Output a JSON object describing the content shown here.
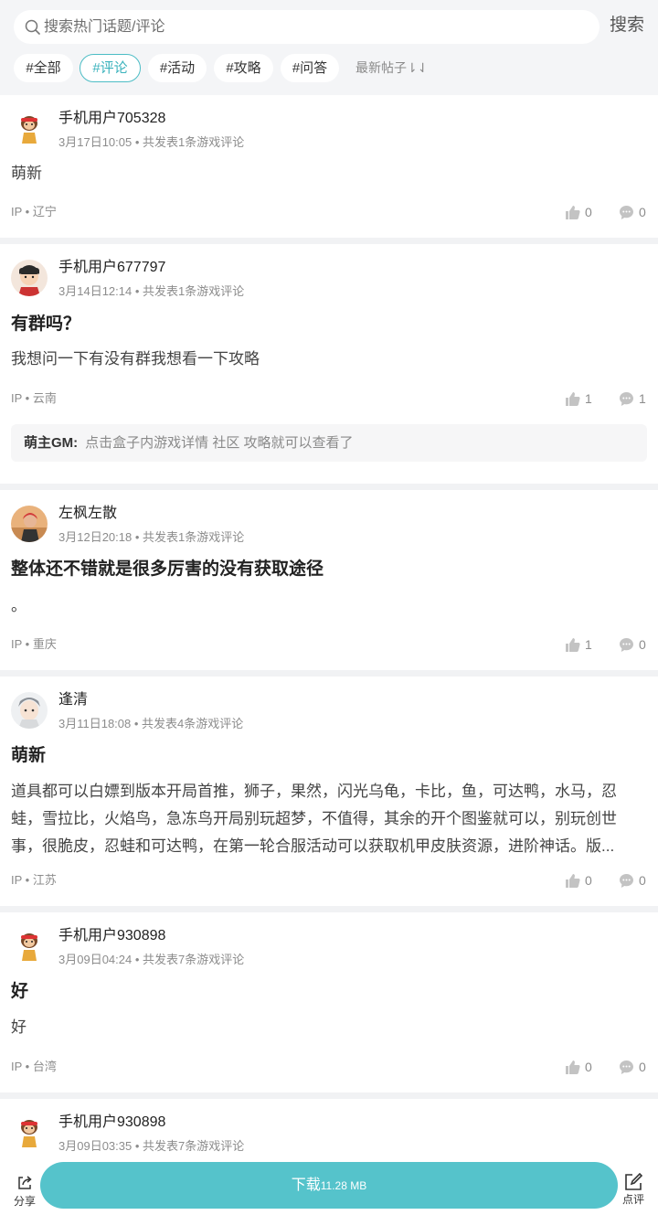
{
  "search": {
    "placeholder": "搜索热门话题/评论",
    "button": "搜索"
  },
  "filters": {
    "chips": [
      "#全部",
      "#评论",
      "#活动",
      "#攻略",
      "#问答"
    ],
    "active_index": 1,
    "sort_label": "最新帖子⇂⇃"
  },
  "posts": [
    {
      "user": "手机用户705328",
      "date": "3月17日10:05",
      "meta_sep": " • ",
      "count_text": "共发表1条游戏评论",
      "title": "",
      "body": "萌新",
      "ip_label": "IP • 辽宁",
      "likes": "0",
      "comments": "0"
    },
    {
      "user": "手机用户677797",
      "date": "3月14日12:14",
      "meta_sep": " • ",
      "count_text": "共发表1条游戏评论",
      "title": "有群吗？",
      "body": "我想问一下有没有群我想看一下攻略",
      "ip_label": "IP • 云南",
      "likes": "1",
      "comments": "1",
      "reply": {
        "who": "萌主GM:",
        "text": "点击盒子内游戏详情 社区 攻略就可以查看了"
      }
    },
    {
      "user": "左枫左散",
      "date": "3月12日20:18",
      "meta_sep": " • ",
      "count_text": "共发表1条游戏评论",
      "title": "整体还不错就是很多厉害的没有获取途径",
      "body": "。",
      "ip_label": "IP • 重庆",
      "likes": "1",
      "comments": "0"
    },
    {
      "user": "逢清",
      "date": "3月11日18:08",
      "meta_sep": " • ",
      "count_text": "共发表4条游戏评论",
      "title": "萌新",
      "body": "道具都可以白嫖到版本开局首推，狮子，果然，闪光乌龟，卡比，鱼，可达鸭，水马，忍蛙，雪拉比，火焰鸟，急冻鸟开局别玩超梦，不值得，其余的开个图鉴就可以，别玩创世事，很脆皮，忍蛙和可达鸭，在第一轮合服活动可以获取机甲皮肤资源，进阶神话。版...",
      "ip_label": "IP • 江苏",
      "likes": "0",
      "comments": "0"
    },
    {
      "user": "手机用户930898",
      "date": "3月09日04:24",
      "meta_sep": " • ",
      "count_text": "共发表7条游戏评论",
      "title": "好",
      "body": "好",
      "ip_label": "IP • 台湾",
      "likes": "0",
      "comments": "0"
    },
    {
      "user": "手机用户930898",
      "date": "3月09日03:35",
      "meta_sep": " • ",
      "count_text": "共发表7条游戏评论"
    }
  ],
  "bottom": {
    "share_label": "分享",
    "download_label": "下载",
    "download_size": "11.28 MB",
    "review_label": "点评"
  },
  "colors": {
    "accent": "#55c3cb",
    "active_chip": "#39b2bc"
  }
}
